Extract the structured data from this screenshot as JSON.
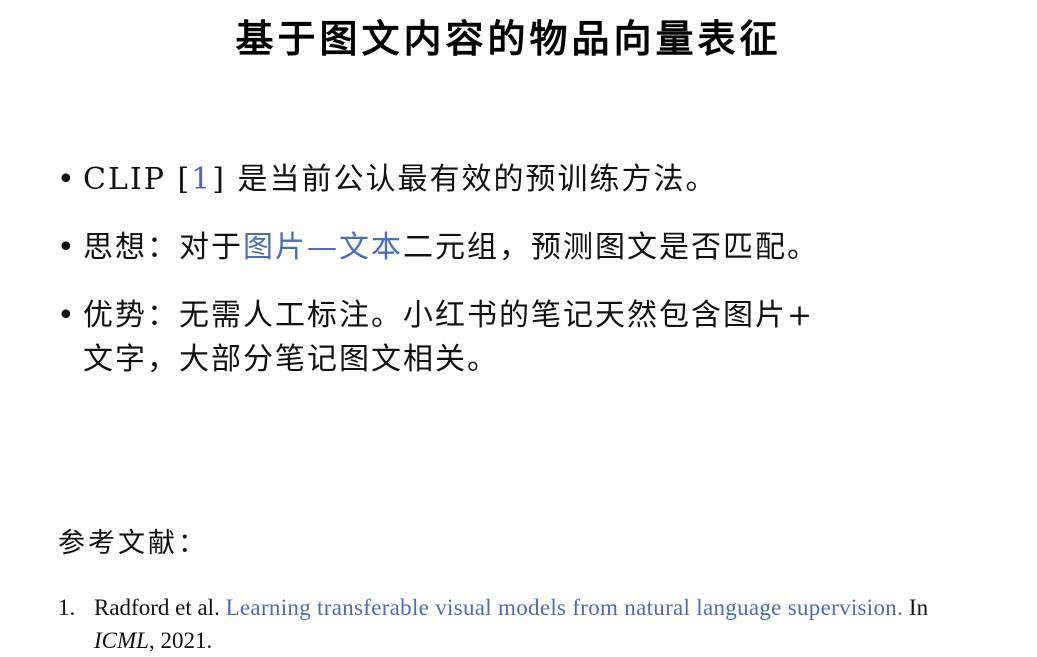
{
  "slide": {
    "title": "基于图文内容的物品向量表征",
    "bullets": [
      {
        "pre": "CLIP [",
        "cite": "1",
        "post": "] 是当前公认最有效的预训练方法。"
      },
      {
        "pre": "思想：对于",
        "accent": "图片—文本",
        "post": "二元组，预测图文是否匹配。"
      },
      {
        "line1": "优势：无需人工标注。小红书的笔记天然包含图片+",
        "line2": "文字，大部分笔记图文相关。"
      }
    ],
    "references": {
      "heading": "参考文献：",
      "items": [
        {
          "number": "1.",
          "authors": "Radford et al.",
          "title": "Learning transferable visual models from natural language supervision.",
          "in": "In",
          "venue": "ICML",
          "year": ", 2021."
        }
      ]
    }
  },
  "colors": {
    "accent": "#4a6db5",
    "text": "#111111"
  }
}
